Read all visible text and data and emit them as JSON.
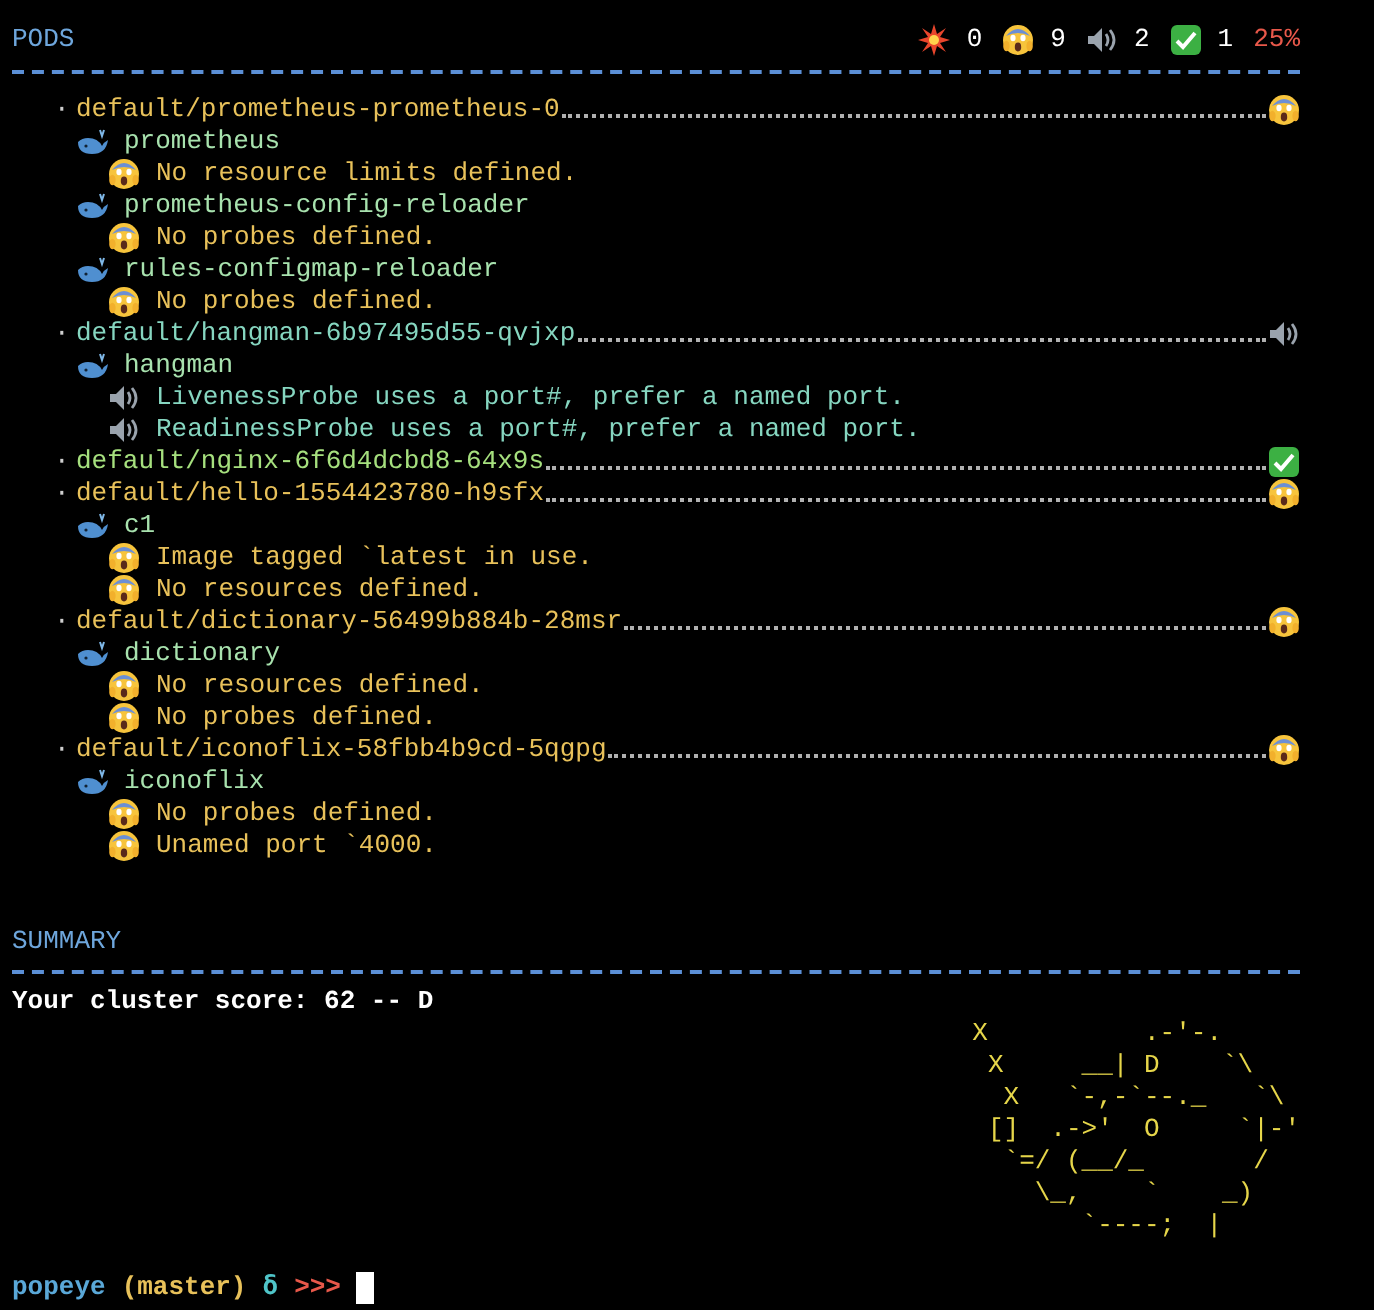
{
  "pods_section": {
    "title": "PODS",
    "tallies": [
      {
        "kind": "error",
        "count": "0"
      },
      {
        "kind": "warning",
        "count": "9"
      },
      {
        "kind": "info",
        "count": "2"
      },
      {
        "kind": "ok",
        "count": "1"
      }
    ],
    "score_percent": "25%"
  },
  "pods": [
    {
      "bullet": "·",
      "name": "default/prometheus-prometheus-0",
      "kind": "warning",
      "containers": [
        {
          "name": "prometheus",
          "issues": [
            {
              "kind": "warning",
              "text": "No resource limits defined."
            }
          ]
        },
        {
          "name": "prometheus-config-reloader",
          "issues": [
            {
              "kind": "warning",
              "text": "No probes defined."
            }
          ]
        },
        {
          "name": "rules-configmap-reloader",
          "issues": [
            {
              "kind": "warning",
              "text": "No probes defined."
            }
          ]
        }
      ]
    },
    {
      "bullet": "·",
      "name": "default/hangman-6b97495d55-qvjxp",
      "kind": "info",
      "containers": [
        {
          "name": "hangman",
          "issues": [
            {
              "kind": "info",
              "text": "LivenessProbe uses a port#, prefer a named port."
            },
            {
              "kind": "info",
              "text": "ReadinessProbe uses a port#, prefer a named port."
            }
          ]
        }
      ]
    },
    {
      "bullet": "·",
      "name": "default/nginx-6f6d4dcbd8-64x9s",
      "kind": "ok"
    },
    {
      "bullet": "·",
      "name": "default/hello-1554423780-h9sfx",
      "kind": "warning",
      "containers": [
        {
          "name": "c1",
          "issues": [
            {
              "kind": "warning",
              "text": "Image tagged `latest in use."
            },
            {
              "kind": "warning",
              "text": "No resources defined."
            }
          ]
        }
      ]
    },
    {
      "bullet": "·",
      "name": "default/dictionary-56499b884b-28msr",
      "kind": "warning",
      "containers": [
        {
          "name": "dictionary",
          "issues": [
            {
              "kind": "warning",
              "text": "No resources defined."
            },
            {
              "kind": "warning",
              "text": "No probes defined."
            }
          ]
        }
      ]
    },
    {
      "bullet": "·",
      "name": "default/iconoflix-58fbb4b9cd-5qgpg",
      "kind": "warning",
      "containers": [
        {
          "name": "iconoflix",
          "issues": [
            {
              "kind": "warning",
              "text": "No probes defined."
            },
            {
              "kind": "warning",
              "text": "Unamed port `4000."
            }
          ]
        }
      ]
    }
  ],
  "summary": {
    "title": "SUMMARY",
    "score_line": "Your cluster score: 62 -- D",
    "logo_lines": [
      "X          .-'-.",
      " X     __| D    `\\",
      "  X   `-,-`--._   `\\",
      " []  .->'  O     `|-'",
      "  `=/ (__/_       /",
      "    \\_,    `    _)",
      "       `----;  |"
    ]
  },
  "prompt": {
    "directory": "popeye",
    "branch": "(master)",
    "symbol": "δ",
    "arrows": ">>>"
  }
}
